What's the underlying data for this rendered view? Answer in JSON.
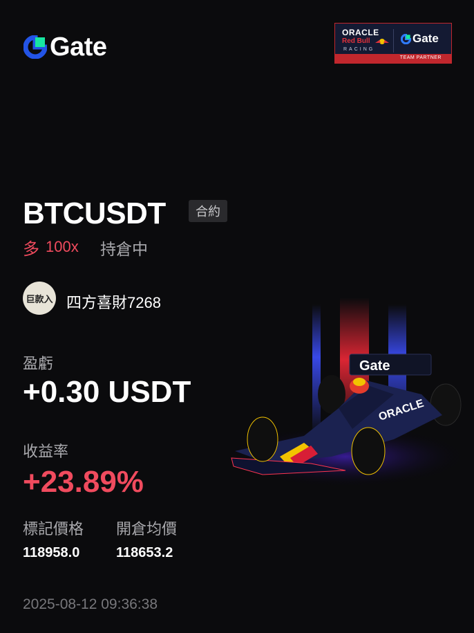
{
  "header": {
    "logo_text": "Gate",
    "partner": {
      "line1": "ORACLE",
      "line2": "Red Bull",
      "line3": "RACING",
      "brand": "Gate",
      "strip": "TEAM PARTNER"
    }
  },
  "position": {
    "symbol": "BTCUSDT",
    "tag": "合約",
    "side": "多",
    "leverage": "100x",
    "status": "持倉中"
  },
  "user": {
    "avatar_text": "巨款入",
    "name": "四方喜財7268"
  },
  "pnl": {
    "label": "盈虧",
    "value": "+0.30 USDT"
  },
  "roi": {
    "label": "收益率",
    "value": "+23.89%"
  },
  "prices": {
    "mark_label": "標記價格",
    "mark_value": "118958.0",
    "entry_label": "開倉均價",
    "entry_value": "118653.2"
  },
  "timestamp": "2025-08-12 09:36:38",
  "colors": {
    "background": "#0b0b0d",
    "accent_red": "#f04b5e",
    "gate_blue": "#2354e6",
    "gate_green": "#17e6a1",
    "muted": "#a9a9ad"
  },
  "icons": [
    "gate-logo-icon",
    "race-car-illustration"
  ]
}
